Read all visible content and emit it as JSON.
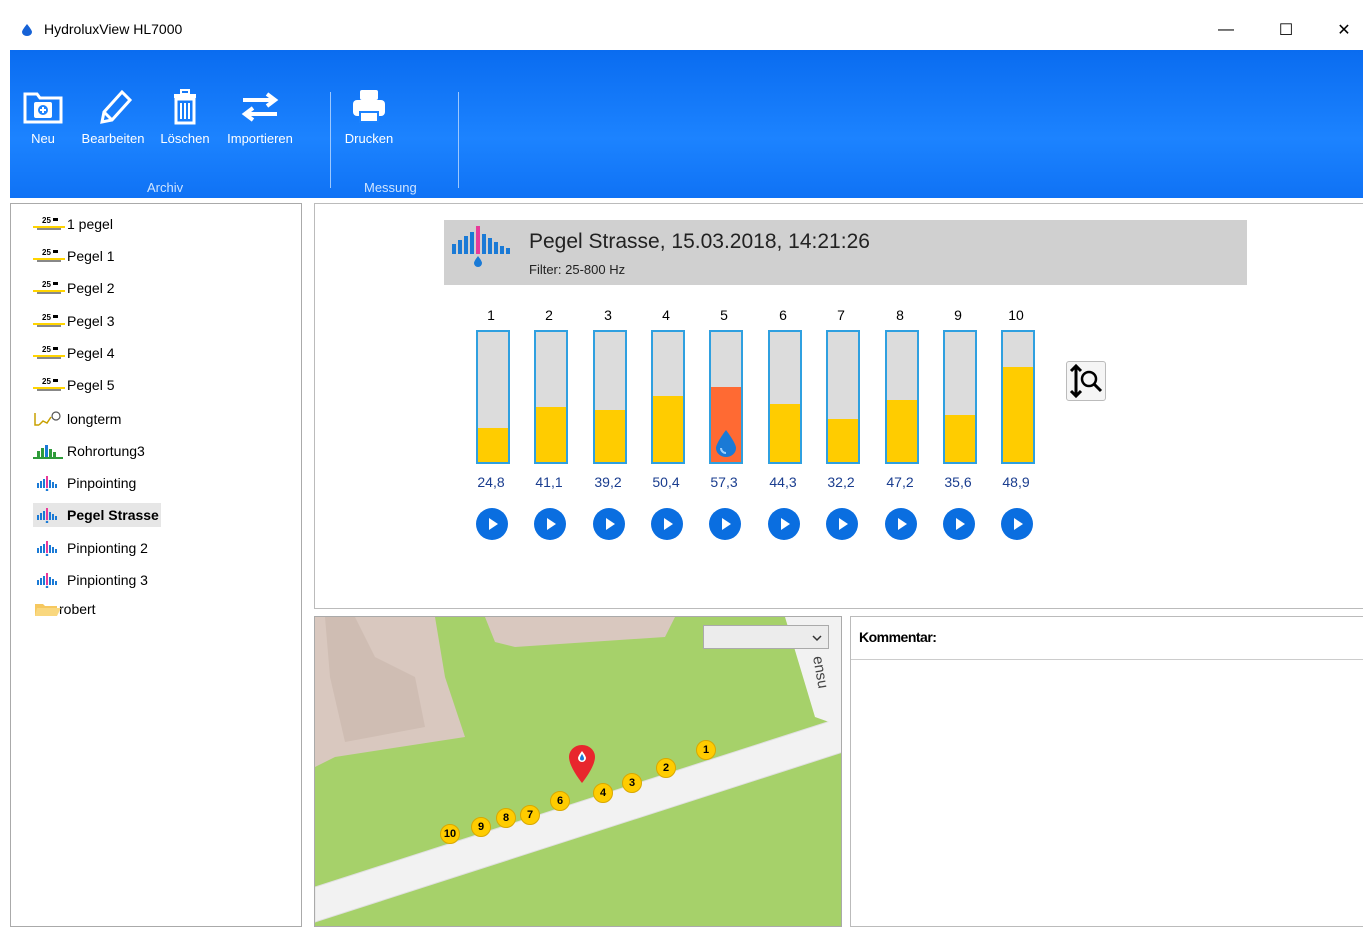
{
  "window": {
    "title": "HydroluxView HL7000",
    "minimize": "—",
    "maximize": "☐",
    "close": "✕"
  },
  "ribbon": {
    "buttons": [
      {
        "label": "Neu",
        "icon": "new-folder-icon"
      },
      {
        "label": "Bearbeiten",
        "icon": "pencil-icon"
      },
      {
        "label": "Löschen",
        "icon": "trash-icon"
      },
      {
        "label": "Importieren",
        "icon": "import-arrows-icon"
      },
      {
        "label": "Drucken",
        "icon": "printer-icon"
      }
    ],
    "groups": [
      "Archiv",
      "Messung"
    ]
  },
  "tree": [
    {
      "label": "1 pegel",
      "icon": "pegel-icon",
      "badge": "25"
    },
    {
      "label": "Pegel 1",
      "icon": "pegel-icon",
      "badge": "25"
    },
    {
      "label": "Pegel 2",
      "icon": "pegel-icon",
      "badge": "25"
    },
    {
      "label": "Pegel 3",
      "icon": "pegel-icon",
      "badge": "25"
    },
    {
      "label": "Pegel 4",
      "icon": "pegel-icon",
      "badge": "25"
    },
    {
      "label": "Pegel 5",
      "icon": "pegel-icon",
      "badge": "25"
    },
    {
      "label": "longterm",
      "icon": "longterm-icon"
    },
    {
      "label": "Rohrortung3",
      "icon": "rohrortung-icon"
    },
    {
      "label": "Pinpointing",
      "icon": "pinpointing-icon"
    },
    {
      "label": "Pegel Strasse",
      "icon": "pinpointing-icon",
      "selected": true
    },
    {
      "label": "Pinpionting 2",
      "icon": "pinpointing-icon"
    },
    {
      "label": "Pinpionting 3",
      "icon": "pinpointing-icon"
    },
    {
      "label": "robert",
      "icon": "folder-icon"
    }
  ],
  "measurement": {
    "title": "Pegel Strasse, 15.03.2018, 14:21:26",
    "filter": "Filter: 25-800 Hz",
    "colors": {
      "bar_fill": "#ffcc00",
      "bar_active": "#ff6a33",
      "bar_border": "#2fa0e0",
      "play": "#0a6ee0"
    },
    "bars": [
      {
        "num": "1",
        "value": "24,8",
        "level": 0.26
      },
      {
        "num": "2",
        "value": "41,1",
        "level": 0.42
      },
      {
        "num": "3",
        "value": "39,2",
        "level": 0.4
      },
      {
        "num": "4",
        "value": "50,4",
        "level": 0.51
      },
      {
        "num": "5",
        "value": "57,3",
        "level": 0.58,
        "active": true
      },
      {
        "num": "6",
        "value": "44,3",
        "level": 0.45
      },
      {
        "num": "7",
        "value": "32,2",
        "level": 0.33
      },
      {
        "num": "8",
        "value": "47,2",
        "level": 0.48
      },
      {
        "num": "9",
        "value": "35,6",
        "level": 0.36
      },
      {
        "num": "10",
        "value": "48,9",
        "level": 0.73
      }
    ]
  },
  "map": {
    "select_value": "",
    "street_label": "ensu",
    "markers": [
      "1",
      "2",
      "3",
      "4",
      "6",
      "7",
      "8",
      "9",
      "10"
    ]
  },
  "comment": {
    "label": "Kommentar:"
  }
}
